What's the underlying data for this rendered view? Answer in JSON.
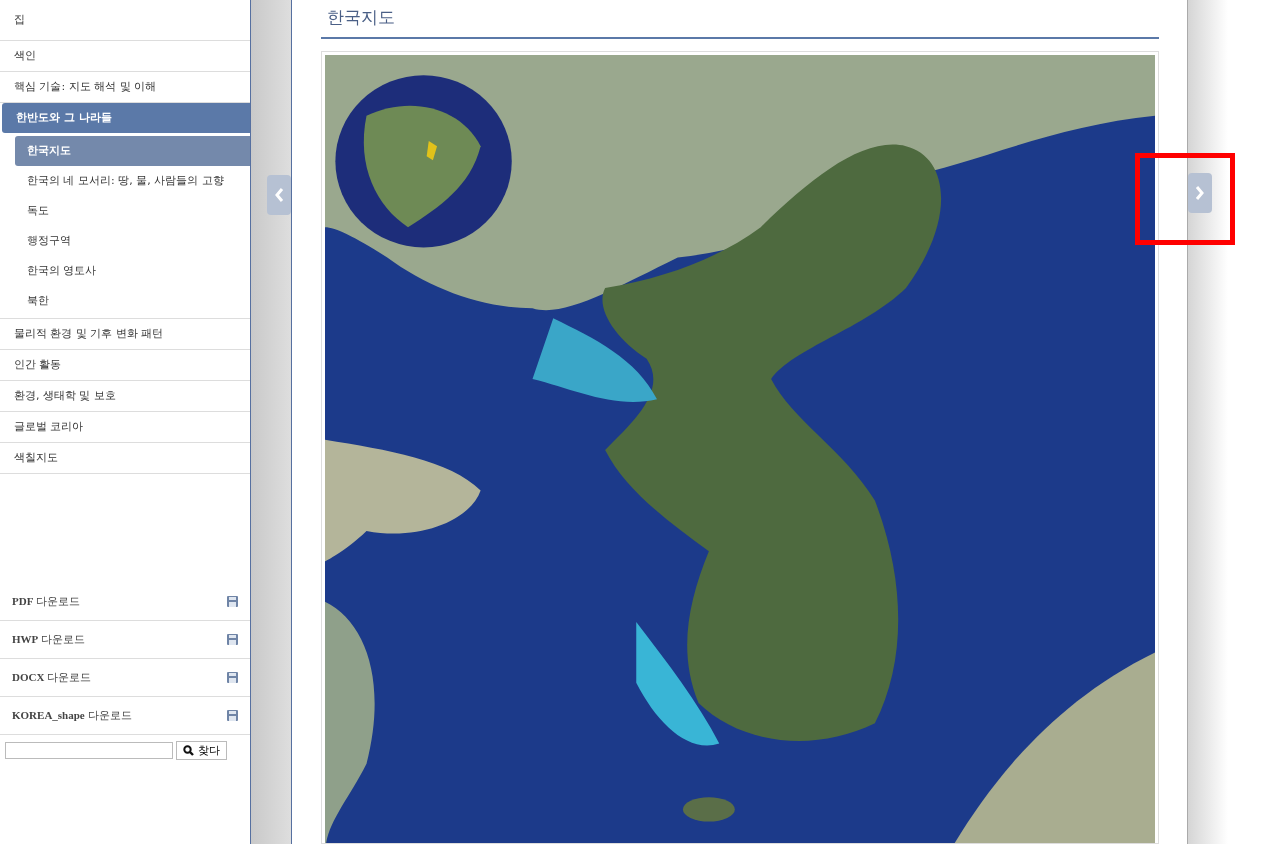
{
  "sidebar": {
    "nav": [
      {
        "label": "집",
        "selected": false
      },
      {
        "label": "색인",
        "selected": false
      },
      {
        "label": "핵심 기술: 지도 해석 및 이해",
        "selected": false
      },
      {
        "label": "한반도와 그 나라들",
        "selected": true,
        "children": [
          {
            "label": "한국지도",
            "selected": true
          },
          {
            "label": "한국의 네 모서리: 땅, 물, 사람들의 고향",
            "selected": false
          },
          {
            "label": "독도",
            "selected": false
          },
          {
            "label": "행정구역",
            "selected": false
          },
          {
            "label": "한국의 영토사",
            "selected": false
          },
          {
            "label": "북한",
            "selected": false
          }
        ]
      },
      {
        "label": "물리적 환경 및 기후 변화 패턴",
        "selected": false
      },
      {
        "label": "인간 활동",
        "selected": false
      },
      {
        "label": "환경, 생태학 및 보호",
        "selected": false
      },
      {
        "label": "글로벌 코리아",
        "selected": false
      },
      {
        "label": "색칠지도",
        "selected": false
      }
    ],
    "downloads": [
      {
        "format": "PDF",
        "label": "다운로드"
      },
      {
        "format": "HWP",
        "label": "다운로드"
      },
      {
        "format": "DOCX",
        "label": "다운로드"
      },
      {
        "format": "KOREA_shape",
        "label": "다운로드"
      }
    ],
    "search": {
      "button": "찾다"
    }
  },
  "page": {
    "title": "한국지도"
  },
  "next_button": {
    "highlighted": true
  }
}
